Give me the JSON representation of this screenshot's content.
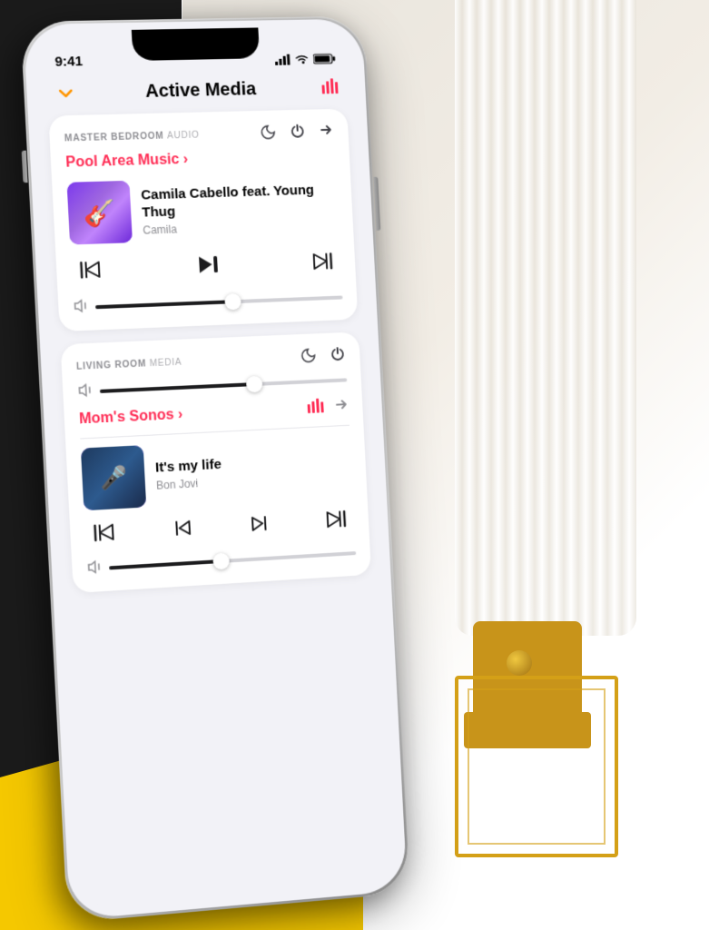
{
  "background": {
    "dark_left": "#1a1a1a",
    "yellow": "#f5c800",
    "room_gradient": "#e8e4dc"
  },
  "status_bar": {
    "time": "9:41",
    "signal_label": "signal",
    "wifi_label": "wifi",
    "battery_label": "battery"
  },
  "header": {
    "title": "Active Media",
    "chevron_icon": "chevron-down",
    "eq_icon": "equalizer"
  },
  "cards": [
    {
      "id": "master-bedroom",
      "zone": "MASTER BEDROOM",
      "type": "AUDIO",
      "source_link": "Pool Area Music ›",
      "controls_top": [
        "moon",
        "power",
        "arrow-right"
      ],
      "track": {
        "title": "Camila Cabello feat. Young Thug",
        "album": "Camila",
        "art": "camila"
      },
      "player_controls": [
        "skip-back",
        "play-pause",
        "skip-forward"
      ],
      "volume": {
        "mute_icon": "volume-off",
        "fill_percent": 55
      }
    },
    {
      "id": "living-room",
      "zone": "LIVING ROOM",
      "type": "MEDIA",
      "controls_top": [
        "moon",
        "power"
      ],
      "source_link": "Mom's Sonos ›",
      "eq_visible": true,
      "arrow_visible": true,
      "track": {
        "title": "It's my life",
        "album": "Bon Jovi",
        "art": "bonjovi"
      },
      "player_controls": [
        "skip-back",
        "prev",
        "next",
        "skip-forward"
      ],
      "volume": {
        "mute_icon": "volume-off",
        "fill_percent": 45
      },
      "volume_top": {
        "fill_percent": 62
      }
    }
  ]
}
